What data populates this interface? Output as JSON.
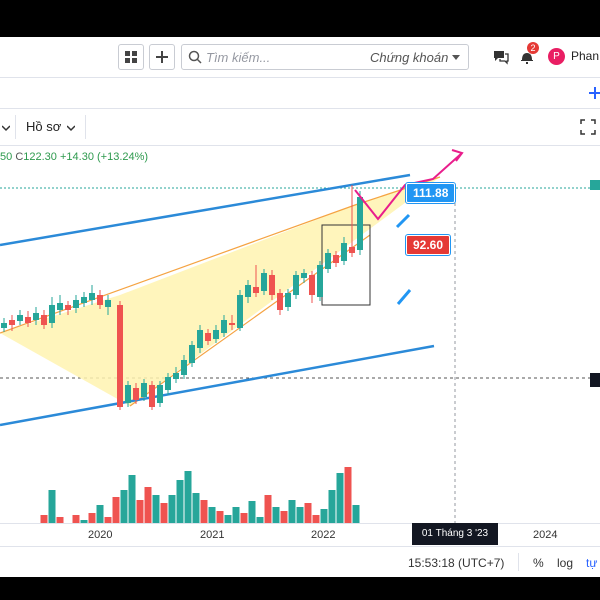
{
  "header": {
    "search_placeholder": "Tìm kiếm...",
    "market_label": "Chứng khoán",
    "notification_count": "2",
    "user_initial": "P",
    "user_name": "Phan"
  },
  "toolbar": {
    "profile_label": "Hồ sơ"
  },
  "legend": {
    "ohlc_prefix": "50",
    "close_label": "C",
    "close_value": "122.30",
    "change": "+14.30",
    "change_pct": "(+13.24%)"
  },
  "annotations": {
    "target_high": "111.88",
    "target_low": "92.60"
  },
  "time_axis": {
    "ticks": [
      "2020",
      "2021",
      "2022",
      "2024"
    ],
    "crosshair_date": "01 Tháng 3 '23"
  },
  "footer": {
    "clock": "15:53:18 (UTC+7)",
    "percent_label": "%",
    "log_label": "log",
    "auto_label": "tự"
  },
  "colors": {
    "up": "#26a69a",
    "down": "#ef5350",
    "channel": "#2b8ad8",
    "wedge_fill": "#fff3b0",
    "wedge_stroke": "#f5a342",
    "projection": "#e91e8c",
    "label_blue": "#2196f3",
    "label_red": "#e53935"
  }
}
